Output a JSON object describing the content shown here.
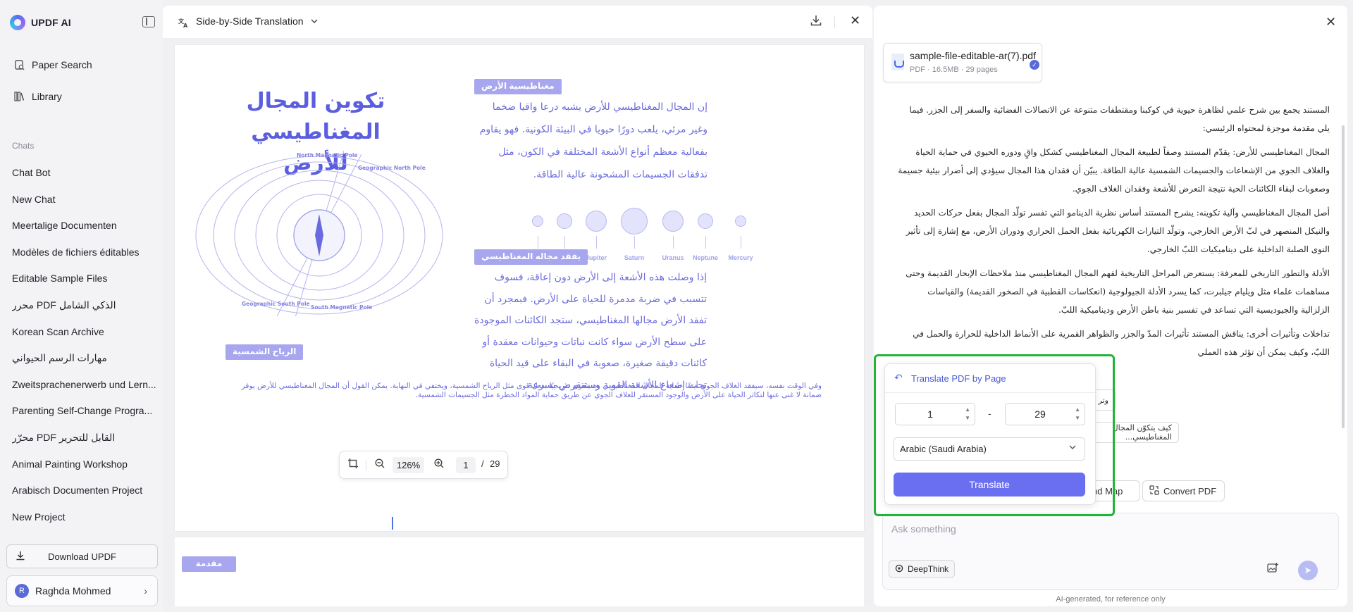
{
  "brand": {
    "name": "UPDF AI"
  },
  "nav": [
    {
      "label": "Paper Search",
      "icon": "paper-search-icon"
    },
    {
      "label": "Library",
      "icon": "library-icon"
    }
  ],
  "chats": {
    "header": "Chats",
    "items": [
      "Chat Bot",
      "New Chat",
      "Meertalige Documenten",
      "Modèles de fichiers éditables",
      "Editable Sample Files",
      "محرر PDF الذكي الشامل",
      "Korean Scan Archive",
      "مهارات الرسم الحيواني",
      "Zweitsprachenerwerb und Lern...",
      "Parenting Self-Change Progra...",
      "محرّر PDF القابل للتحرير",
      "Animal Painting Workshop",
      "Arabisch Documenten Project",
      "New Project"
    ]
  },
  "download": {
    "label": "Download UPDF"
  },
  "user": {
    "initial": "R",
    "name": "Raghda Mohmed"
  },
  "viewer": {
    "mode_label": "Side-by-Side Translation",
    "zoom": "126%",
    "page_current": "1",
    "page_sep": "/",
    "page_total": "29"
  },
  "document": {
    "title": "تكوين المجال المغناطيسي للأرض",
    "tag1": "مغناطيسية الأرض",
    "para1": "إن المجال المغناطيسي للأرض يشبه درعا واقيا ضخما وغير مرئي، يلعب دورًا حيويا في البيئة الكونية. فهو يقاوم بفعالية معظم أنواع الأشعة المختلفة في الكون، مثل تدفقات الجسيمات المشحونة عالية الطاقة.",
    "tag2": "يفقد مجاله المغناطيسي",
    "para2": "إذا وصلت هذه الأشعة إلى الأرض دون إعاقة، فسوف تتسبب في ضربة مدمرة للحياة على الأرض. فبمجرد أن تفقد الأرض مجالها المغناطيسي، ستجد الكائنات الموجودة على سطح الأرض سواء كانت نباتات وحيوانات معقدة أو كائنات دقيقة صغيرة، صعوبة في البقاء على قيد الحياة تحت إشعاع الأشعة القوية وستنقرض بسرعة",
    "tag3": "الرياح الشمسية",
    "footer": "وفي الوقت نفسه، سيفقد الغلاف الجوي أيضًا حماية المجال المغناطيسي وسيتعرى تدريجيًا بفعل قوى مثل الرياح الشمسية، ويختفي في النهاية. يمكن القول أن المجال المغناطيسي للأرض يوفر ضمانة لا غنى عنها لتكاثر الحياة على الأرض والوجود المستقر للغلاف الجوي عن طريق حماية المواد الخطرة مثل الجسيمات الشمسية.",
    "page2_tag": "مقدمة",
    "diagram_labels": {
      "north_magnetic": "North Magnetic Pole",
      "geographic_north": "Geographic North Pole",
      "geographic_south": "Geographic South Pole",
      "south_magnetic": "South Magnetic Pole"
    },
    "planets": [
      "Venus",
      "Mars",
      "Jupiter",
      "Saturn",
      "Uranus",
      "Neptune",
      "Mercury"
    ]
  },
  "file": {
    "name": "sample-file-editable-ar(7).pdf",
    "meta": "PDF · 16.5MB · 29 pages"
  },
  "answer": [
    "المستند يجمع بين شرح علمي لظاهرة حيوية في كوكبنا ومقتطفات متنوعة عن الاتصالات الفضائية والسفر إلى الجزر. فيما يلي مقدمة موجزة لمحتواه الرئيسي:",
    "المجال المغناطيسي للأرض: يقدّم المستند وصفاً لطبيعة المجال المغناطيسي كشكل واقٍ ودوره الحيوي في حماية الحياة والغلاف الجوي من الإشعاعات والجسيمات الشمسية عالية الطاقة. يبيّن أن فقدان هذا المجال سيؤدي إلى أضرار بيئية جسيمة وصعوبات لبقاء الكائنات الحية نتيجة التعرض للأشعة وفقدان الغلاف الجوي.",
    "أصل المجال المغناطيسي وآلية تكوينه: يشرح المستند أساس نظرية الدينامو التي تفسر تولّد المجال بفعل حركات الحديد والنيكل المنصهر في لبّ الأرض الخارجي، وتولّد التيارات الكهربائية بفعل الحمل الحراري ودوران الأرض، مع إشارة إلى تأثير النوى الصلبة الداخلية على ديناميكيات اللبّ الخارجي.",
    "الأدلة والتطور التاريخي للمعرفة: يستعرض المراحل التاريخية لفهم المجال المغناطيسي منذ ملاحظات الإبحار القديمة وحتى مساهمات علماء مثل ويليام جيلبرت، كما يسرد الأدلة الجيولوجية (انعكاسات القطبية في الصخور القديمة) والقياسات الزلزالية والجيوديسية التي تساعد في تفسير بنية باطن الأرض وديناميكية اللبّ.",
    "تداخلات وتأثيرات أخرى: يناقش المستند تأثيرات المدّ والجزر والظواهر القمرية على الأنماط الداخلية للحرارة والحمل في اللبّ، وكيف يمكن أن تؤثر هذه العملي"
  ],
  "chips": {
    "chip_left": "وتر",
    "chip_right": "كيف يتكوّن المجال المغناطيسي...",
    "mind_map": "nd Map",
    "convert_pdf": "Convert PDF"
  },
  "ask": {
    "placeholder": "Ask something",
    "deepthink": "DeepThink"
  },
  "ai_note": "AI-generated, for reference only",
  "popup": {
    "title": "Translate PDF by Page",
    "from": "1",
    "dash": "-",
    "to": "29",
    "language": "Arabic (Saudi Arabia)",
    "button": "Translate"
  }
}
